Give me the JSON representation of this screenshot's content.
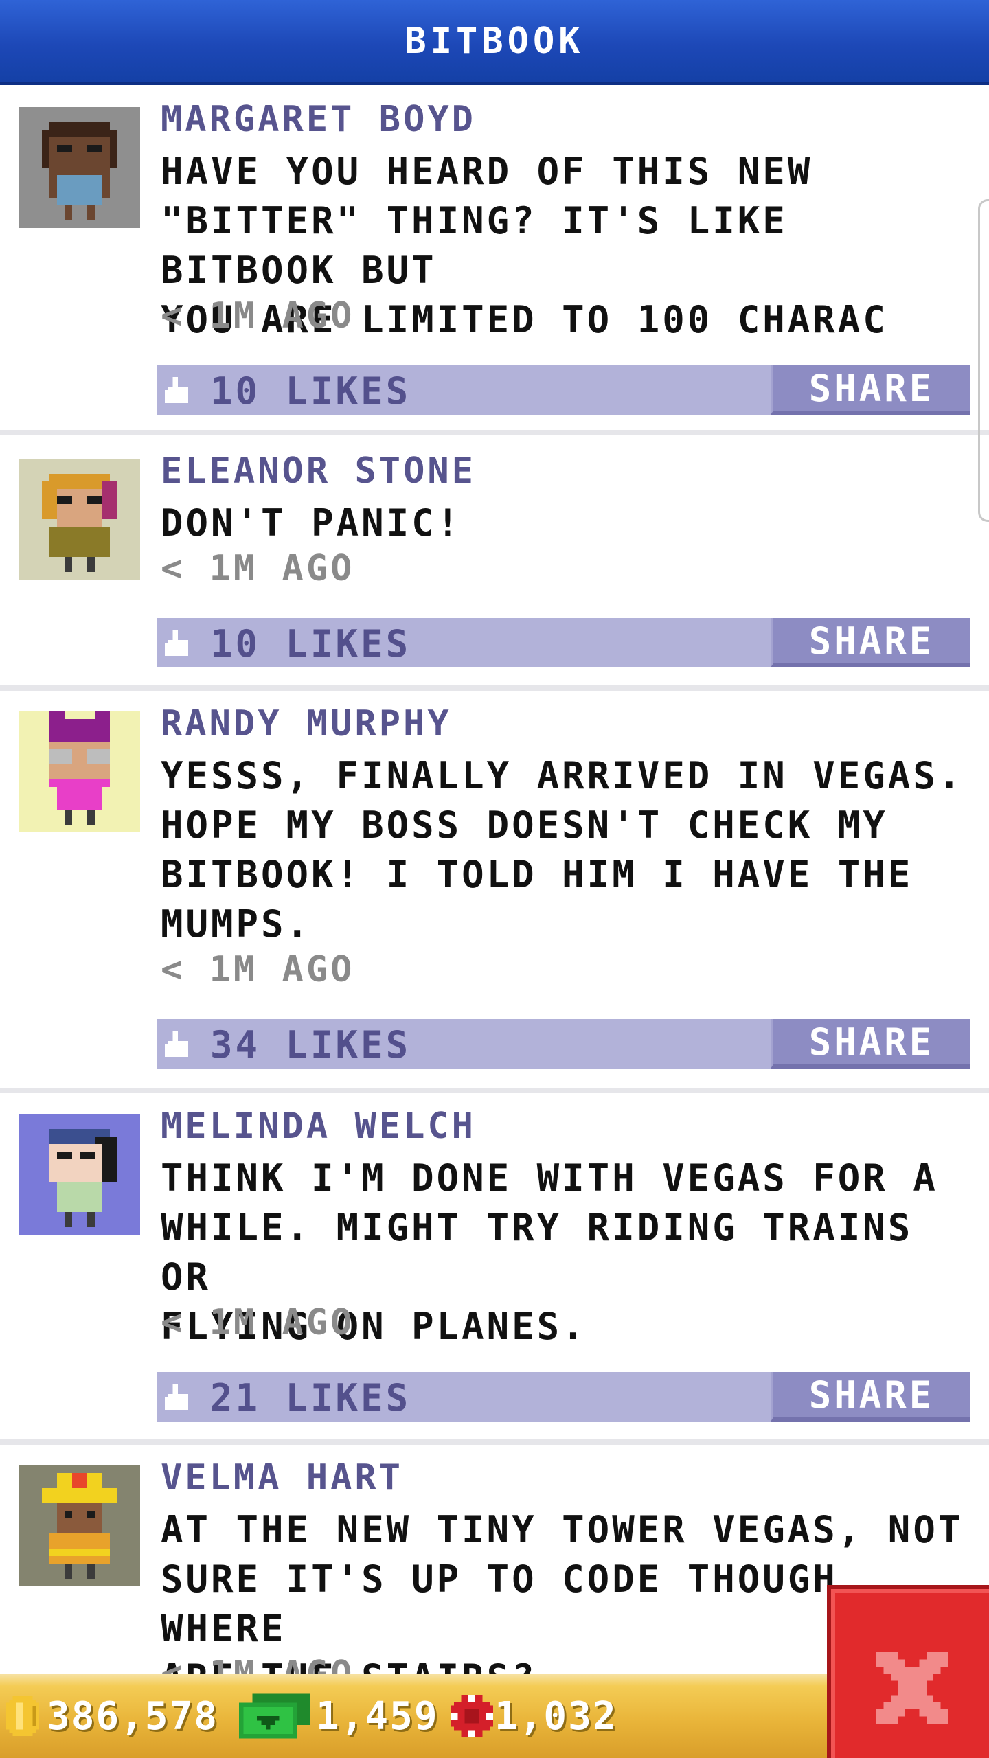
{
  "header": {
    "title": "BITBOOK"
  },
  "posts": [
    {
      "name": "MARGARET BOYD",
      "text": "HAVE YOU HEARD OF THIS NEW\n\"BITTER\" THING? IT'S LIKE BITBOOK BUT\nYOU ARE LIMITED TO 100 CHARAC",
      "time": "< 1M AGO",
      "likes": "10 LIKES",
      "share": "SHARE",
      "avatar_bg": "#8f8f8f"
    },
    {
      "name": "ELEANOR STONE",
      "text": "DON'T PANIC!",
      "time": "< 1M AGO",
      "likes": "10 LIKES",
      "share": "SHARE",
      "avatar_bg": "#d4d3b6"
    },
    {
      "name": "RANDY MURPHY",
      "text": "YESSS, FINALLY ARRIVED IN VEGAS.\nHOPE MY BOSS DOESN'T CHECK MY\nBITBOOK! I TOLD HIM I HAVE THE\nMUMPS.",
      "time": "< 1M AGO",
      "likes": "34 LIKES",
      "share": "SHARE",
      "avatar_bg": "#f2f2b3"
    },
    {
      "name": "MELINDA WELCH",
      "text": "THINK I'M DONE WITH VEGAS FOR A\nWHILE. MIGHT TRY RIDING TRAINS OR\nFLYING ON PLANES.",
      "time": "< 1M AGO",
      "likes": "21 LIKES",
      "share": "SHARE",
      "avatar_bg": "#7a7ad9"
    },
    {
      "name": "VELMA HART",
      "text": "AT THE NEW TINY TOWER VEGAS, NOT\nSURE IT'S UP TO CODE THOUGH. WHERE\nARE THE STAIRS?",
      "time": "< 1M AGO",
      "avatar_bg": "#84846f"
    }
  ],
  "resources": {
    "coins": "386,578",
    "bux": "1,459",
    "chips": "1,032"
  },
  "icons": {
    "like": "thumbs-up-icon",
    "coin": "coin-icon",
    "bux": "bux-icon",
    "chip": "casino-chip-icon",
    "close": "close-icon"
  },
  "colors": {
    "header": "#1d48b7",
    "like_bar": "#b2b2d9",
    "share_button": "#8d8cc3",
    "name_text": "#57548e",
    "close_button": "#e12a2c",
    "bottom_bar": "#e9b53a"
  }
}
